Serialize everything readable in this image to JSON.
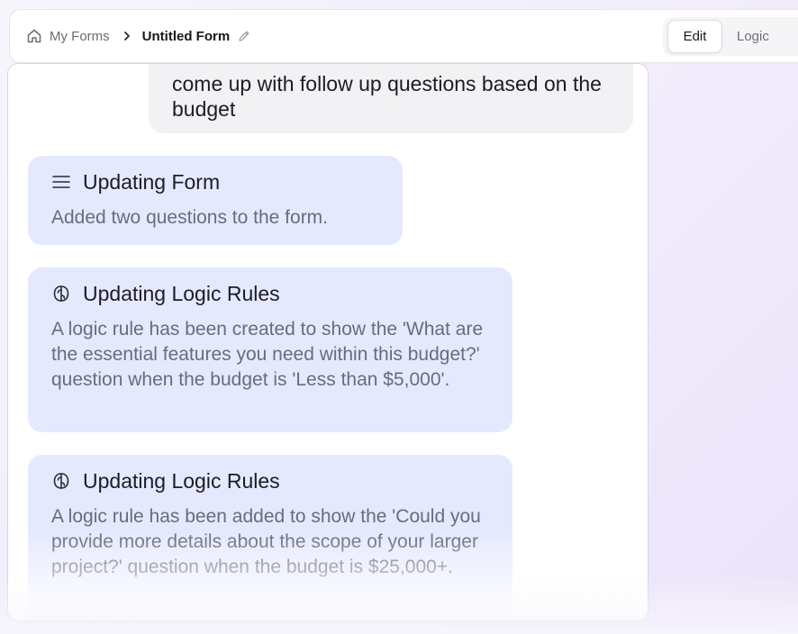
{
  "breadcrumb": {
    "root_label": "My Forms",
    "current_label": "Untitled Form"
  },
  "tabs": {
    "edit_label": "Edit",
    "logic_label": "Logic"
  },
  "chat": {
    "user_message": "come up with follow up questions based on the budget",
    "cards": [
      {
        "icon": "menu-lines-icon",
        "title": "Updating Form",
        "body": "Added two questions to the form."
      },
      {
        "icon": "brain-icon",
        "title": "Updating Logic Rules",
        "body": "A logic rule has been created to show the 'What are the essential features you need within this budget?' question when the budget is 'Less than $5,000'."
      },
      {
        "icon": "brain-icon",
        "title": "Updating Logic Rules",
        "body": "A logic rule has been added to show the 'Could you provide more details about the scope of your larger project?' question when the budget is $25,000+."
      }
    ]
  },
  "colors": {
    "card_bg": "#e5e9fd",
    "user_bubble_bg": "#f2f2f4",
    "page_bg": "#f1ebfb"
  }
}
